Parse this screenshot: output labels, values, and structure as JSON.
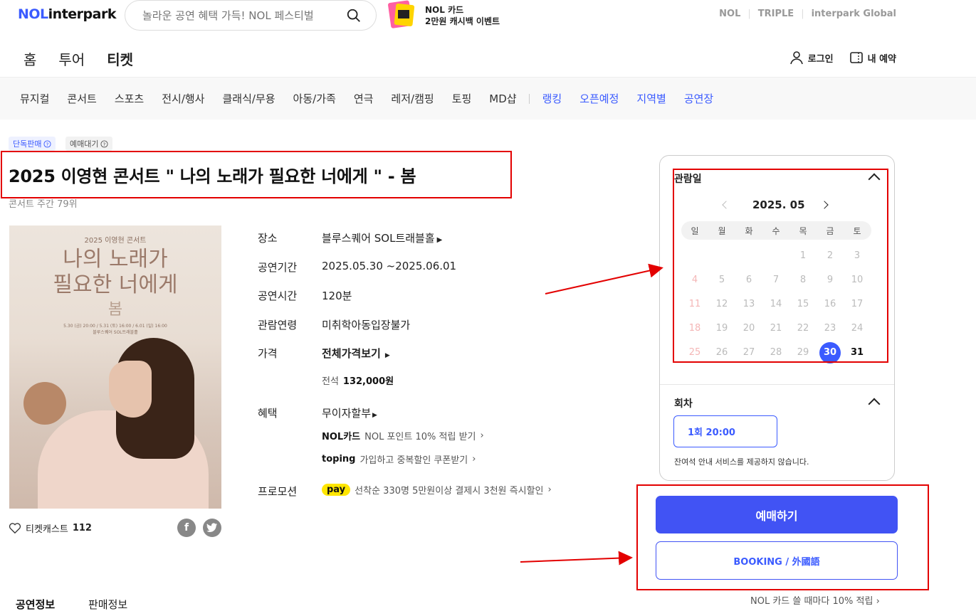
{
  "header": {
    "logo_nol": "NOL",
    "logo_interpark": "interpark",
    "search_placeholder": "놀라운 공연 혜택 가득! NOL 페스티벌",
    "promo_line1": "NOL 카드",
    "promo_line2": "2만원 캐시백 이벤트",
    "family_links": [
      "NOL",
      "TRIPLE",
      "interpark Global"
    ]
  },
  "main_nav": {
    "items": [
      "홈",
      "투어",
      "티켓"
    ],
    "active": "티켓",
    "login": "로그인",
    "my_reservation": "내 예약"
  },
  "sub_nav": {
    "items": [
      "뮤지컬",
      "콘서트",
      "스포츠",
      "전시/행사",
      "클래식/무용",
      "아동/가족",
      "연극",
      "레저/캠핑",
      "토핑",
      "MD샵"
    ],
    "blue_items": [
      "랭킹",
      "오픈예정",
      "지역별",
      "공연장"
    ]
  },
  "product": {
    "badge1": "단독판매",
    "badge2": "예매대기",
    "title": "2025 이영현 콘서트 \" 나의 노래가 필요한 너에게 \" - 봄",
    "subtitle": "콘서트 주간 79위",
    "poster": {
      "line1": "2025 이영현 콘서트",
      "line2": "나의 노래가",
      "line3": "필요한 너에게",
      "line4": "봄",
      "line5": "5.30 (금) 20:00 / 5.31 (토) 16:00 / 6.01 (일) 16:00",
      "line6": "블루스퀘어 SOL트래블홀"
    },
    "likes_label": "티켓캐스트",
    "likes_count": "112"
  },
  "info": {
    "venue_label": "장소",
    "venue": "블루스퀘어 SOL트래블홀",
    "period_label": "공연기간",
    "period": "2025.05.30 ~2025.06.01",
    "runtime_label": "공연시간",
    "runtime": "120분",
    "age_label": "관람연령",
    "age": "미취학아동입장불가",
    "price_label": "가격",
    "price_link": "전체가격보기",
    "seat_grade": "전석",
    "seat_price": "132,000원",
    "benefit_label": "혜택",
    "benefit_main": "무이자할부",
    "benefit1_logo": "NOL카드",
    "benefit1_text": "NOL 포인트 10% 적립 받기",
    "benefit2_logo": "toping",
    "benefit2_text": "가입하고 중복할인 쿠폰받기",
    "promo_label": "프로모션",
    "promo_logo": "pay",
    "promo_text": "선착순 330명 5만원이상 결제시 3천원 즉시할인"
  },
  "calendar": {
    "title": "관람일",
    "month": "2025. 05",
    "weekdays": [
      "일",
      "월",
      "화",
      "수",
      "목",
      "금",
      "토"
    ],
    "weeks": [
      [
        "",
        "",
        "",
        "",
        "1",
        "2",
        "3"
      ],
      [
        "4",
        "5",
        "6",
        "7",
        "8",
        "9",
        "10"
      ],
      [
        "11",
        "12",
        "13",
        "14",
        "15",
        "16",
        "17"
      ],
      [
        "18",
        "19",
        "20",
        "21",
        "22",
        "23",
        "24"
      ],
      [
        "25",
        "26",
        "27",
        "28",
        "29",
        "30",
        "31"
      ]
    ],
    "selected": "30",
    "available": [
      "30",
      "31"
    ]
  },
  "round": {
    "title": "회차",
    "option": "1회 20:00",
    "notice": "잔여석 안내 서비스를 제공하지 않습니다."
  },
  "actions": {
    "book": "예매하기",
    "book_foreign": "BOOKING / 外國語",
    "nol_card": "NOL 카드 쓸 때마다 10% 적립"
  },
  "tabs": [
    "공연정보",
    "판매정보"
  ],
  "colors": {
    "brand": "#3b5bff",
    "button": "#4153f4",
    "annotation": "#e30000"
  }
}
